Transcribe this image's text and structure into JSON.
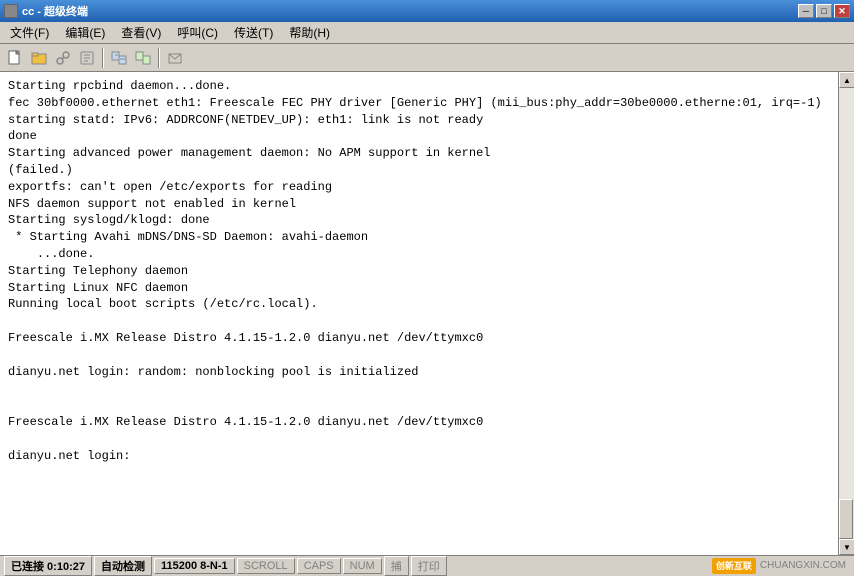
{
  "window": {
    "title": "cc - 超级终端",
    "icon": "terminal-icon"
  },
  "titlebar": {
    "minimize_label": "─",
    "maximize_label": "□",
    "close_label": "✕"
  },
  "menubar": {
    "items": [
      {
        "label": "文件(F)"
      },
      {
        "label": "编辑(E)"
      },
      {
        "label": "查看(V)"
      },
      {
        "label": "呼叫(C)"
      },
      {
        "label": "传送(T)"
      },
      {
        "label": "帮助(H)"
      }
    ]
  },
  "toolbar": {
    "buttons": [
      {
        "name": "new-btn",
        "icon": "📄"
      },
      {
        "name": "open-btn",
        "icon": "📂"
      },
      {
        "name": "disconnect-btn",
        "icon": "🔌"
      },
      {
        "name": "properties-btn",
        "icon": "⚙"
      },
      {
        "name": "group1-btn",
        "icon": "📋"
      },
      {
        "name": "group2-btn",
        "icon": "📋"
      },
      {
        "name": "send-btn",
        "icon": "📤"
      }
    ]
  },
  "terminal": {
    "content": "Starting rpcbind daemon...done.\nfec 30bf0000.ethernet eth1: Freescale FEC PHY driver [Generic PHY] (mii_bus:phy_addr=30be0000.etherne:01, irq=-1)\nstarting statd: IPv6: ADDRCONF(NETDEV_UP): eth1: link is not ready\ndone\nStarting advanced power management daemon: No APM support in kernel\n(failed.)\nexportfs: can't open /etc/exports for reading\nNFS daemon support not enabled in kernel\nStarting syslogd/klogd: done\n * Starting Avahi mDNS/DNS-SD Daemon: avahi-daemon\n    ...done.\nStarting Telephony daemon\nStarting Linux NFC daemon\nRunning local boot scripts (/etc/rc.local).\n\nFreescale i.MX Release Distro 4.1.15-1.2.0 dianyu.net /dev/ttymxc0\n\ndianyu.net login: random: nonblocking pool is initialized\n\n\nFreescale i.MX Release Distro 4.1.15-1.2.0 dianyu.net /dev/ttymxc0\n\ndianyu.net login: "
  },
  "statusbar": {
    "items": [
      {
        "label": "已连接 0:10:27",
        "active": true
      },
      {
        "label": "自动检测",
        "active": true
      },
      {
        "label": "115200 8-N-1",
        "active": true
      },
      {
        "label": "SCROLL",
        "active": false
      },
      {
        "label": "CAPS",
        "active": false
      },
      {
        "label": "NUM",
        "active": false
      },
      {
        "label": "捕",
        "active": false
      },
      {
        "label": "打印",
        "active": false
      }
    ],
    "watermark": {
      "box_label": "创新互联",
      "url_label": "CHUANGXIN.COM"
    }
  }
}
